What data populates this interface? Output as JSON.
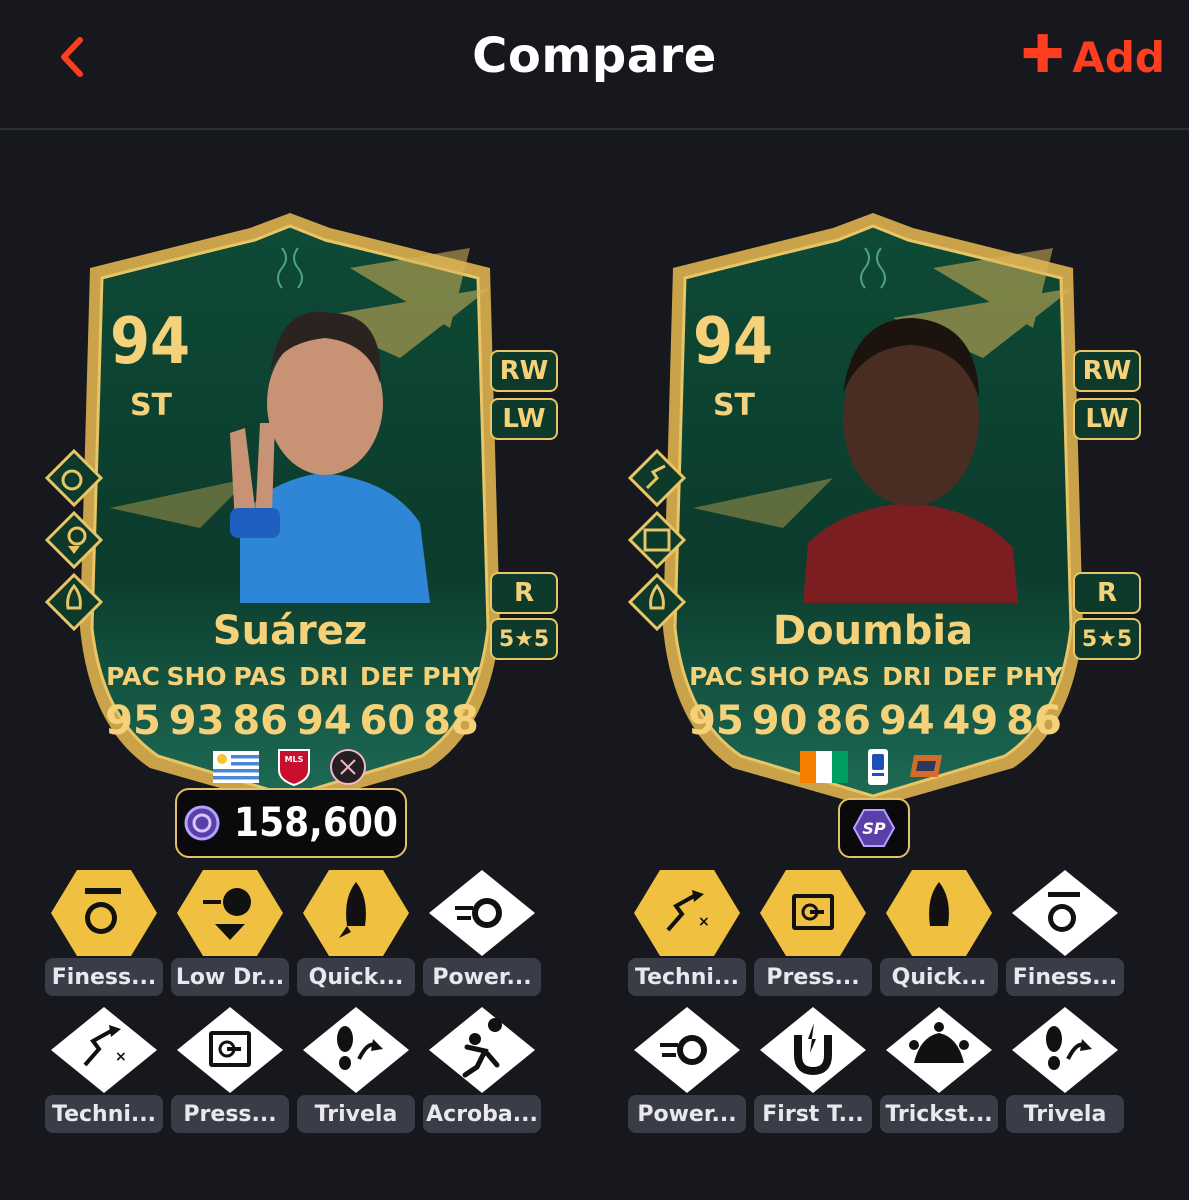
{
  "header": {
    "back_icon": "chevron-left-icon",
    "title": "Compare",
    "add_label": "Add",
    "accent": "#ff3d1f"
  },
  "cards": [
    {
      "rating": "94",
      "position": "ST",
      "alt_positions": [
        "RW",
        "LW"
      ],
      "foot": "R",
      "skill_weak": "5★5",
      "name": "Suárez",
      "stat_labels": [
        "PAC",
        "SHO",
        "PAS",
        "DRI",
        "DEF",
        "PHY"
      ],
      "stats": [
        "95",
        "93",
        "86",
        "94",
        "60",
        "88"
      ],
      "badges": [
        "finesse-shot-icon",
        "low-driven-shot-icon",
        "quick-step-icon"
      ],
      "price": "158,600",
      "playstyles_row1": [
        "Finess...",
        "Low Dr...",
        "Quick...",
        "Power..."
      ],
      "playstyles_row2": [
        "Techni...",
        "Press...",
        "Trivela",
        "Acroba..."
      ]
    },
    {
      "rating": "94",
      "position": "ST",
      "alt_positions": [
        "RW",
        "LW"
      ],
      "foot": "R",
      "skill_weak": "5★5",
      "name": "Doumbia",
      "stat_labels": [
        "PAC",
        "SHO",
        "PAS",
        "DRI",
        "DEF",
        "PHY"
      ],
      "stats": [
        "95",
        "90",
        "86",
        "94",
        "49",
        "86"
      ],
      "badges": [
        "technical-icon",
        "press-proven-icon",
        "quick-step-icon"
      ],
      "sp_label": "SP",
      "playstyles_row1": [
        "Techni...",
        "Press...",
        "Quick...",
        "Finess..."
      ],
      "playstyles_row2": [
        "Power...",
        "First T...",
        "Trickst...",
        "Trivela"
      ]
    }
  ],
  "colors": {
    "gold": "#f5d27a",
    "plus_bg": "#f0c040",
    "base_bg": "#ffffff",
    "label_bg": "#3a3c47"
  }
}
